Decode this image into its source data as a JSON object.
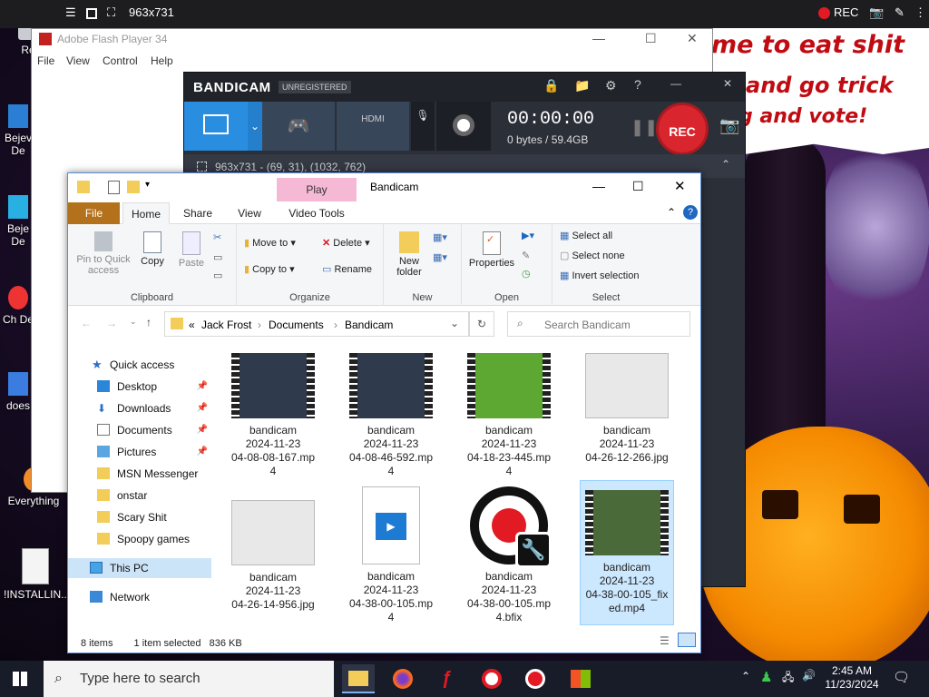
{
  "capture_bar": {
    "size": "963x731",
    "rec": "REC"
  },
  "meme": {
    "line1": "me to eat shit",
    "line2": "and go trick",
    "line3": "g and vote!"
  },
  "desktop": {
    "icons": [
      "Recy",
      "Bejev De",
      "Beje De",
      "Ch De",
      "does",
      "Everything",
      "!INSTALLIN..."
    ]
  },
  "flash": {
    "title": "Adobe Flash Player 34",
    "menu": [
      "File",
      "View",
      "Control",
      "Help"
    ]
  },
  "bandicam": {
    "logo": "BANDICAM",
    "unregistered": "UNREGISTERED",
    "timer": "00:00:00",
    "bytes": "0 bytes / 59.4GB",
    "rec": "REC",
    "geometry": "963x731 - (69, 31), (1032, 762)",
    "hdmi": "HDMI"
  },
  "explorer": {
    "title": "Bandicam",
    "play": "Play",
    "tabs": [
      "File",
      "Home",
      "Share",
      "View",
      "Video Tools"
    ],
    "ribbon": {
      "clipboard": {
        "label": "Clipboard",
        "pin": "Pin to Quick access",
        "copy": "Copy",
        "paste": "Paste"
      },
      "organize": {
        "label": "Organize",
        "move": "Move to",
        "copyto": "Copy to",
        "delete": "Delete",
        "rename": "Rename"
      },
      "new": {
        "label": "New",
        "folder": "New folder"
      },
      "open": {
        "label": "Open",
        "properties": "Properties"
      },
      "select": {
        "label": "Select",
        "all": "Select all",
        "none": "Select none",
        "invert": "Invert selection"
      }
    },
    "breadcrumb": [
      "«",
      "Jack Frost",
      "Documents",
      "Bandicam"
    ],
    "search_placeholder": "Search Bandicam",
    "nav": [
      {
        "label": "Quick access",
        "pin": false
      },
      {
        "label": "Desktop",
        "pin": true
      },
      {
        "label": "Downloads",
        "pin": true
      },
      {
        "label": "Documents",
        "pin": true
      },
      {
        "label": "Pictures",
        "pin": true
      },
      {
        "label": "MSN Messenger",
        "pin": false
      },
      {
        "label": "onstar",
        "pin": false
      },
      {
        "label": "Scary Shit",
        "pin": false
      },
      {
        "label": "Spoopy games",
        "pin": false
      },
      {
        "label": "This PC",
        "pin": false
      },
      {
        "label": "Network",
        "pin": false
      }
    ],
    "files": [
      {
        "l1": "bandicam",
        "l2": "2024-11-23",
        "l3": "04-08-08-167.mp",
        "l4": "4"
      },
      {
        "l1": "bandicam",
        "l2": "2024-11-23",
        "l3": "04-08-46-592.mp",
        "l4": "4"
      },
      {
        "l1": "bandicam",
        "l2": "2024-11-23",
        "l3": "04-18-23-445.mp",
        "l4": "4"
      },
      {
        "l1": "bandicam",
        "l2": "2024-11-23",
        "l3": "04-26-12-266.jpg",
        "l4": ""
      },
      {
        "l1": "bandicam",
        "l2": "2024-11-23",
        "l3": "04-26-14-956.jpg",
        "l4": ""
      },
      {
        "l1": "bandicam",
        "l2": "2024-11-23",
        "l3": "04-38-00-105.mp",
        "l4": "4"
      },
      {
        "l1": "bandicam",
        "l2": "2024-11-23",
        "l3": "04-38-00-105.mp",
        "l4": "4.bfix"
      },
      {
        "l1": "bandicam",
        "l2": "2024-11-23",
        "l3": "04-38-00-105_fix",
        "l4": "ed.mp4"
      }
    ],
    "status": {
      "items": "8 items",
      "selected": "1 item selected",
      "size": "836 KB"
    }
  },
  "taskbar": {
    "search": "Type here to search",
    "time": "2:45 AM",
    "date": "11/23/2024"
  }
}
